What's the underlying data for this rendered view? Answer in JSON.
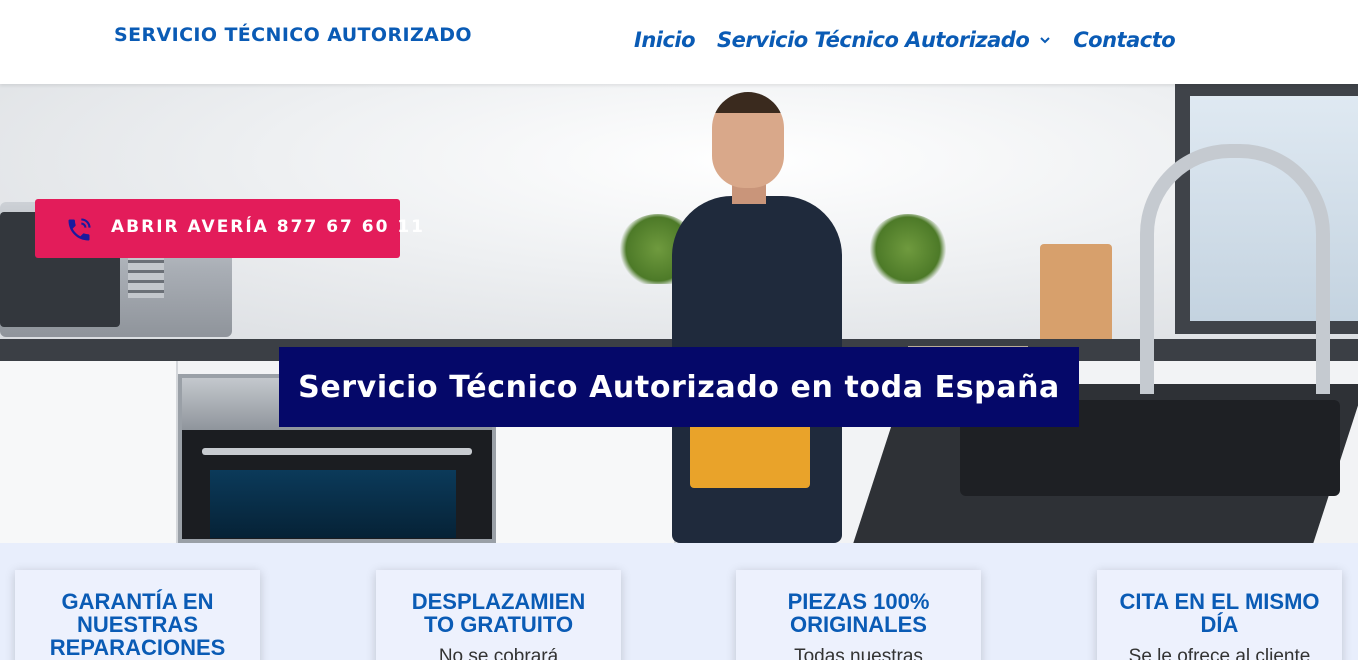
{
  "header": {
    "logo": "SERVICIO TÉCNICO AUTORIZADO",
    "nav": [
      {
        "label": "Inicio"
      },
      {
        "label": "Servicio Técnico Autorizado",
        "has_dropdown": true
      },
      {
        "label": "Contacto"
      }
    ]
  },
  "hero": {
    "call_button_label": "ABRIR AVERÍA 877 67 60 11",
    "title": "Servicio Técnico Autorizado en toda España"
  },
  "features": [
    {
      "title": "GARANTÍA EN NUESTRAS REPARACIONES",
      "text": ""
    },
    {
      "title": "DESPLAZAMIENTO GRATUITO",
      "text": "No se cobrará"
    },
    {
      "title": "PIEZAS 100% ORIGINALES",
      "text": "Todas nuestras"
    },
    {
      "title": "CITA EN EL MISMO DÍA",
      "text": "Se le ofrece al cliente"
    }
  ],
  "colors": {
    "brand_blue": "#0a5bb5",
    "call_button": "#e31c5a",
    "title_box": "#050869",
    "features_bg": "#e8eefc"
  },
  "icons": {
    "phone": "phone-call-icon",
    "nav_dropdown": "chevron-down-icon"
  }
}
